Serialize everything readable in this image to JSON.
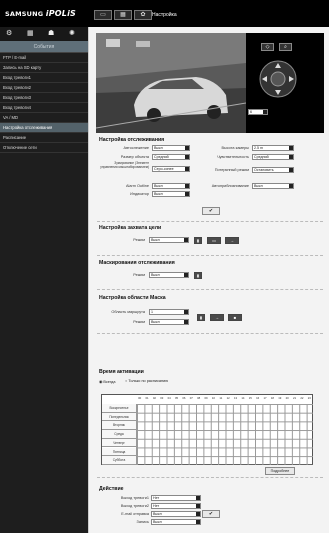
{
  "header": {
    "brand_main": "SAMSUNG",
    "brand_script": "iPOLiS",
    "page_title": "Настройка",
    "icons": [
      "monitor-icon",
      "film-icon",
      "gear-icon"
    ]
  },
  "sidebar": {
    "icons": [
      "list-icon",
      "film-icon",
      "event-icon",
      "settings-icon"
    ],
    "section_title": "События",
    "items": [
      "FTP / E-mail",
      "Запись на SD карту",
      "Вход тревоги1",
      "Вход тревоги2",
      "Вход тревоги3",
      "Вход тревоги4",
      "VA / MD",
      "Настройка отслеживания",
      "Расписание",
      "Отключение сети"
    ],
    "active_index": 7
  },
  "ptz": {
    "preset_value": "6"
  },
  "tracking": {
    "title": "Настройка отслеживания",
    "left": [
      {
        "label": "Автослежение",
        "value": "Выкл"
      },
      {
        "label": "Размер объекта",
        "value": "Средний"
      },
      {
        "label": "Зумирование",
        "value": "Серо-синее"
      },
      {
        "label": "Alarm Outline",
        "value": "Выкл"
      },
      {
        "label": "Индикатор",
        "value": "Выкл"
      }
    ],
    "left_note": "(Элемент управления масштабированием)",
    "right": [
      {
        "label": "Высота камеры",
        "value": "2.5 m"
      },
      {
        "label": "Чувствительность",
        "value": "Средний"
      },
      {
        "label": "Потерянный режим",
        "value": "Остановить"
      },
      {
        "label": "Автоприблизнивание",
        "value": "Выкл"
      }
    ]
  },
  "capture": {
    "title": "Настройка захвата цели",
    "mode_label": "Режим",
    "mode_value": "Выкл"
  },
  "masking": {
    "title": "Маскирования отслеживания",
    "mode_label": "Режим",
    "mode_value": "Выкл"
  },
  "area": {
    "title": "Настройка области Маска",
    "route_label": "Область маршрута",
    "route_value": "1",
    "mode_label": "Режим",
    "mode_value": "Выкл"
  },
  "schedule": {
    "title": "Время активации",
    "opt_always": "Всегда",
    "opt_schedule": "Только по расписанию",
    "days": [
      "Воскресенье",
      "Понедельник",
      "Вторник",
      "Среда",
      "Четверг",
      "Пятница",
      "Суббота"
    ],
    "hours": [
      "00",
      "01",
      "02",
      "03",
      "04",
      "05",
      "06",
      "07",
      "08",
      "09",
      "10",
      "11",
      "12",
      "13",
      "14",
      "15",
      "16",
      "17",
      "18",
      "19",
      "20",
      "21",
      "22",
      "23"
    ],
    "detail_button": "Подробнее"
  },
  "action": {
    "title": "Действие",
    "rows": [
      {
        "label": "Выход тревоги1",
        "value": "Нет"
      },
      {
        "label": "Выход тревоги2",
        "value": "Нет"
      },
      {
        "label": "E-mail отправка",
        "value": "Выкл"
      },
      {
        "label": "Запись",
        "value": "Выкл"
      }
    ]
  },
  "ok_label": "✔"
}
